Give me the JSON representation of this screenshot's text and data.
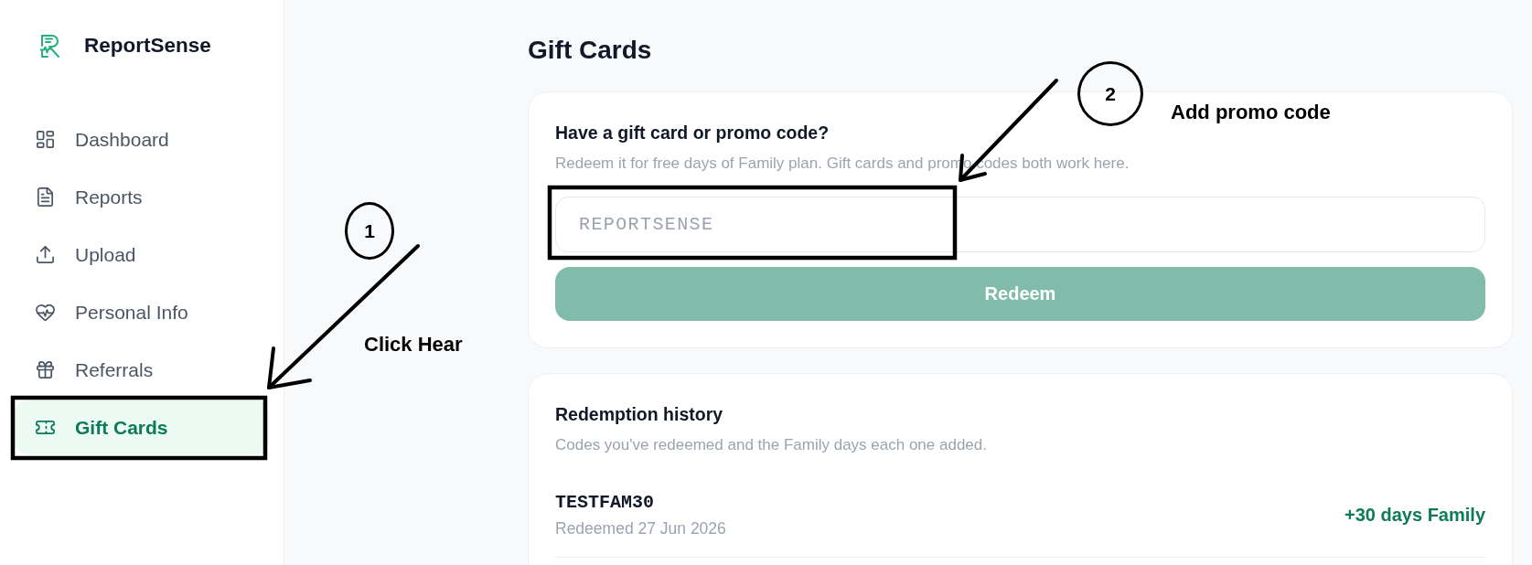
{
  "sidebar": {
    "brand": "ReportSense",
    "items": [
      {
        "label": "Dashboard",
        "selected": false
      },
      {
        "label": "Reports",
        "selected": false
      },
      {
        "label": "Upload",
        "selected": false
      },
      {
        "label": "Personal Info",
        "selected": false
      },
      {
        "label": "Referrals",
        "selected": false
      },
      {
        "label": "Gift Cards",
        "selected": true
      }
    ]
  },
  "page": {
    "title": "Gift Cards"
  },
  "redeem_card": {
    "title": "Have a gift card or promo code?",
    "subtitle": "Redeem it for free days of Family plan. Gift cards and promo codes both work here.",
    "code_field": {
      "placeholder": "REPORTSENSE"
    },
    "button": {
      "label": "Redeem",
      "disabled": true
    }
  },
  "history_card": {
    "title": "Redemption history",
    "subtitle": "Codes you've redeemed and the Family days each one added.",
    "rows": [
      {
        "code": "TESTFAM30",
        "date": "Redeemed 27 Jun 2026",
        "added": "+30 days Family"
      }
    ]
  },
  "annotations": [
    {
      "number": "1",
      "note": "Click Hear"
    },
    {
      "number": "2",
      "note": "Add promo code"
    }
  ]
}
